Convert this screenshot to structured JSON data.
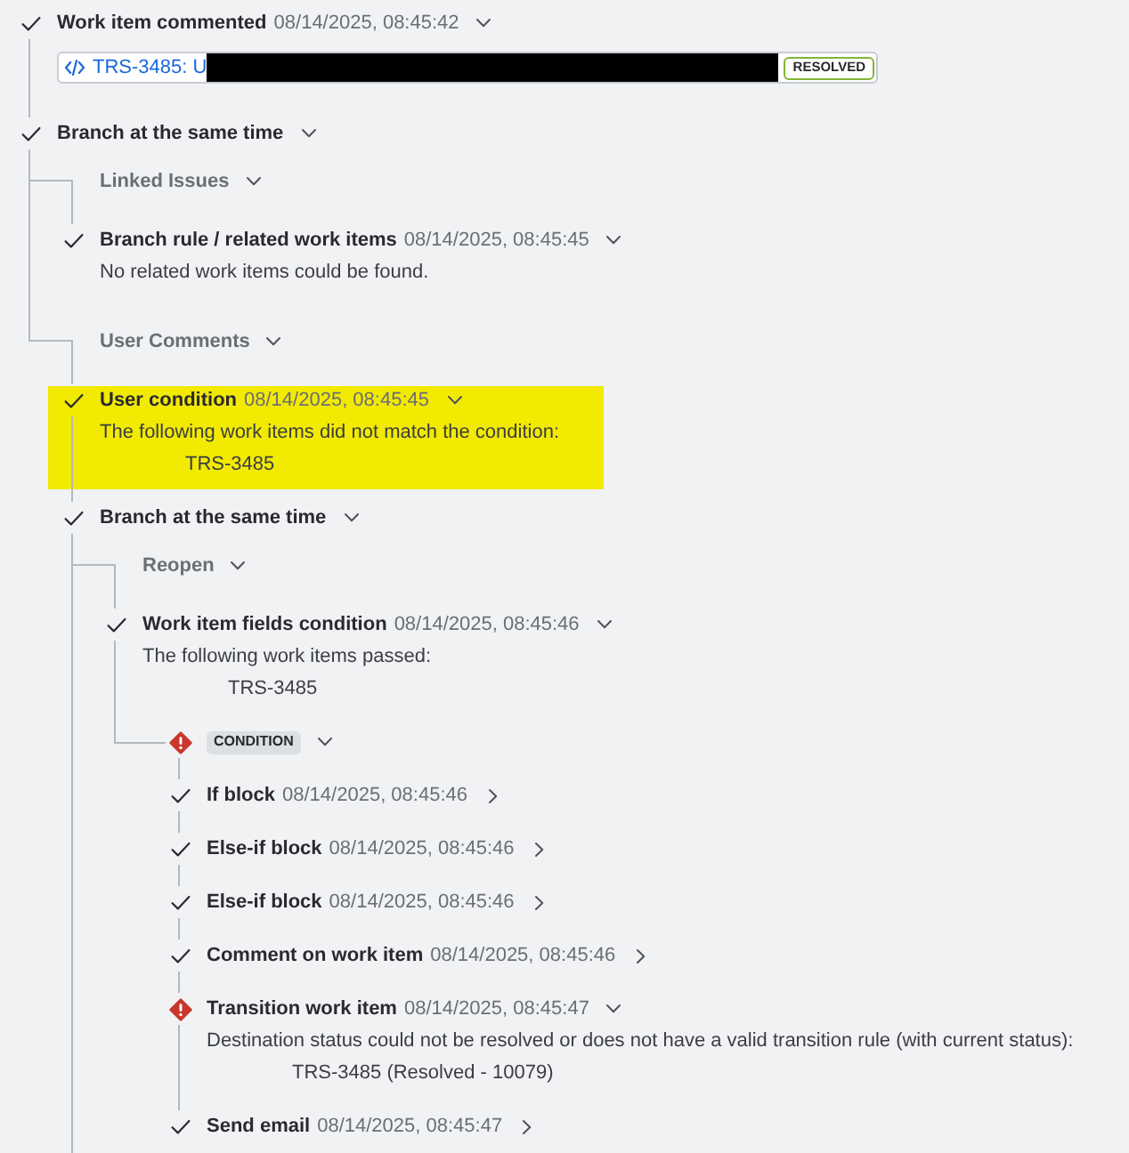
{
  "log": [
    {
      "kind": "step",
      "error": false,
      "title": "Work item commented",
      "time": "08/14/2025, 08:45:42",
      "expanded": true,
      "highlighted": false,
      "link": {
        "text": "TRS-3485: U",
        "redacted": true,
        "status": "RESOLVED"
      }
    },
    {
      "kind": "step",
      "error": false,
      "title": "Branch at the same time",
      "expanded": true,
      "highlighted": false,
      "more_branches_below": false,
      "branches": [
        {
          "label": "Linked Issues",
          "expanded": true,
          "children": [
            {
              "kind": "step",
              "error": false,
              "title": "Branch rule / related work items",
              "time": "08/14/2025, 08:45:45",
              "expanded": true,
              "highlighted": false,
              "description": "No related work items could be found."
            }
          ]
        },
        {
          "label": "User Comments",
          "expanded": true,
          "children": [
            {
              "kind": "step",
              "error": false,
              "title": "User condition",
              "time": "08/14/2025, 08:45:45",
              "expanded": true,
              "highlighted": true,
              "description": "The following work items did not match the condition:",
              "items": [
                "TRS-3485"
              ]
            },
            {
              "kind": "step",
              "error": false,
              "title": "Branch at the same time",
              "expanded": true,
              "highlighted": false,
              "more_branches_below": true,
              "branches": [
                {
                  "label": "Reopen",
                  "expanded": true,
                  "children": [
                    {
                      "kind": "step",
                      "error": false,
                      "title": "Work item fields condition",
                      "time": "08/14/2025, 08:45:46",
                      "expanded": true,
                      "highlighted": false,
                      "description": "The following work items passed:",
                      "items": [
                        "TRS-3485"
                      ]
                    },
                    {
                      "kind": "block",
                      "error": true,
                      "badge": "CONDITION",
                      "expanded": true,
                      "children": [
                        {
                          "kind": "step",
                          "error": false,
                          "title": "If block",
                          "time": "08/14/2025, 08:45:46",
                          "expanded": false,
                          "highlighted": false
                        },
                        {
                          "kind": "step",
                          "error": false,
                          "title": "Else-if block",
                          "time": "08/14/2025, 08:45:46",
                          "expanded": false,
                          "highlighted": false
                        },
                        {
                          "kind": "step",
                          "error": false,
                          "title": "Else-if block",
                          "time": "08/14/2025, 08:45:46",
                          "expanded": false,
                          "highlighted": false
                        },
                        {
                          "kind": "step",
                          "error": false,
                          "title": "Comment on work item",
                          "time": "08/14/2025, 08:45:46",
                          "expanded": false,
                          "highlighted": false
                        },
                        {
                          "kind": "step",
                          "error": true,
                          "title": "Transition work item",
                          "time": "08/14/2025, 08:45:47",
                          "expanded": true,
                          "highlighted": false,
                          "description": "Destination status could not be resolved or does not have a valid transition rule (with current status):",
                          "items": [
                            "TRS-3485 (Resolved - 10079)"
                          ]
                        },
                        {
                          "kind": "step",
                          "error": false,
                          "title": "Send email",
                          "time": "08/14/2025, 08:45:47",
                          "expanded": false,
                          "highlighted": false
                        }
                      ]
                    }
                  ]
                }
              ]
            }
          ]
        }
      ]
    }
  ]
}
